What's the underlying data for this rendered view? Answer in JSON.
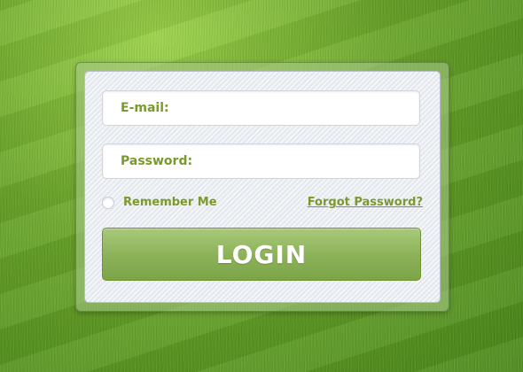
{
  "login_form": {
    "email_placeholder": "E-mail:",
    "password_placeholder": "Password:",
    "remember_label": "Remember Me",
    "remember_checked": false,
    "forgot_link": "Forgot Password?",
    "login_label": "LOGIN"
  },
  "colors": {
    "accent_text": "#7c9a2c",
    "button_top": "#a9c97a",
    "button_bottom": "#7ca447"
  }
}
